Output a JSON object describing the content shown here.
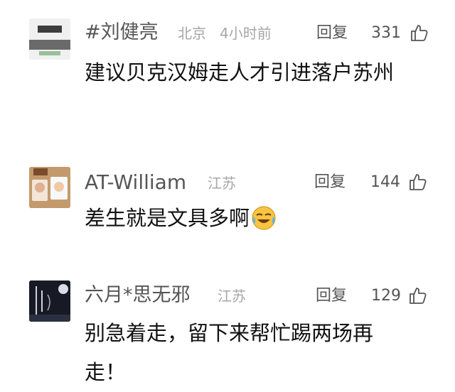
{
  "comments": [
    {
      "name": "#刘健亮",
      "location": "北京",
      "time": "4小时前",
      "reply_label": "回复",
      "likes": "331",
      "text": "建议贝克汉姆走人才引进落户苏州",
      "avatar_icon": "profile-photo"
    },
    {
      "name": "AT-William",
      "location": "江苏",
      "reply_label": "回复",
      "likes": "144",
      "text": "差生就是文具多啊",
      "emoji_icon": "crying-laughing-emoji",
      "avatar_icon": "profile-photo"
    },
    {
      "name": "六月*思无邪",
      "location": "江苏",
      "reply_label": "回复",
      "likes": "129",
      "text": "别急着走，留下来帮忙踢两场再走！",
      "avatar_icon": "profile-photo"
    }
  ],
  "colors": {
    "name": "#555555",
    "location": "#a6a6a6",
    "text": "#111111",
    "background": "#ffffff"
  }
}
